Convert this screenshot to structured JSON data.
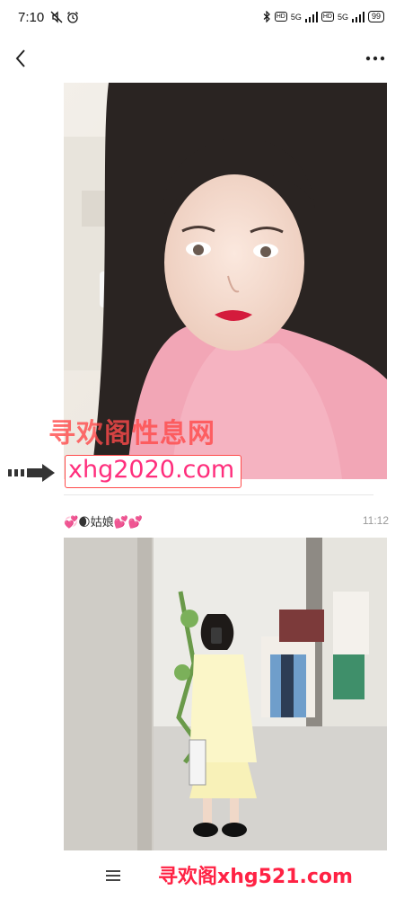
{
  "status_bar": {
    "time": "7:10",
    "hd_label": "HD",
    "network": "5G",
    "battery": "99",
    "icons": [
      "mute-icon",
      "alarm-icon",
      "bluetooth-icon",
      "signal-icon",
      "battery-icon"
    ]
  },
  "nav": {
    "back_icon": "chevron-left-icon",
    "more_icon": "more-dots-icon"
  },
  "message": {
    "sender": "💞🌒姑娘💕💕",
    "time": "11:12"
  },
  "watermarks": {
    "top_text": "寻欢阁性息网",
    "top_url": "xhg2020.com",
    "bottom_text": "寻欢阁xhg521.com"
  },
  "bottom_bar": {
    "menu_icon": "menu-icon"
  },
  "colors": {
    "watermark_red": "#ff2244",
    "watermark_pink": "#ff2e7c",
    "muted_text": "#999999"
  }
}
